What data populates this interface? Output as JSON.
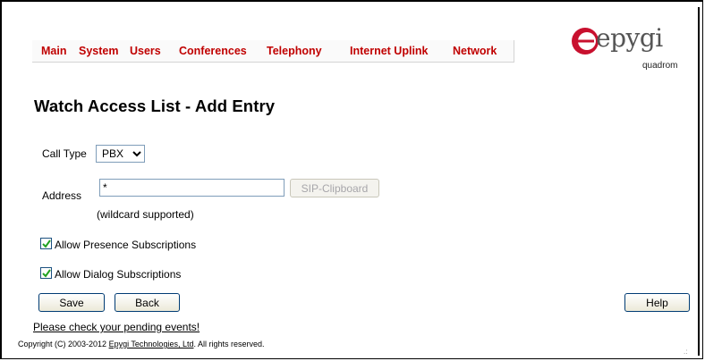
{
  "nav": {
    "items": [
      "Main",
      "System",
      "Users",
      "Conferences",
      "Telephony",
      "Internet Uplink",
      "Network"
    ]
  },
  "logo": {
    "word": "epygi",
    "sub": "quadrom"
  },
  "page": {
    "title": "Watch Access List - Add Entry"
  },
  "form": {
    "call_type_label": "Call Type",
    "call_type_value": "PBX",
    "address_label": "Address",
    "address_value": "*",
    "sip_clipboard_label": "SIP-Clipboard",
    "wildcard_note": "(wildcard supported)",
    "allow_presence_label": "Allow Presence Subscriptions",
    "allow_presence_checked": true,
    "allow_dialog_label": "Allow Dialog Subscriptions",
    "allow_dialog_checked": true
  },
  "buttons": {
    "save": "Save",
    "back": "Back",
    "help": "Help"
  },
  "footer": {
    "pending_link": "Please check your pending events!",
    "copyright_prefix": "Copyright (C) 2003-2012 ",
    "company_link": "Epygi Technologies, Ltd",
    "copyright_suffix": ". All rights reserved."
  },
  "colors": {
    "nav_text": "#c00000",
    "logo_red": "#c8102e"
  }
}
